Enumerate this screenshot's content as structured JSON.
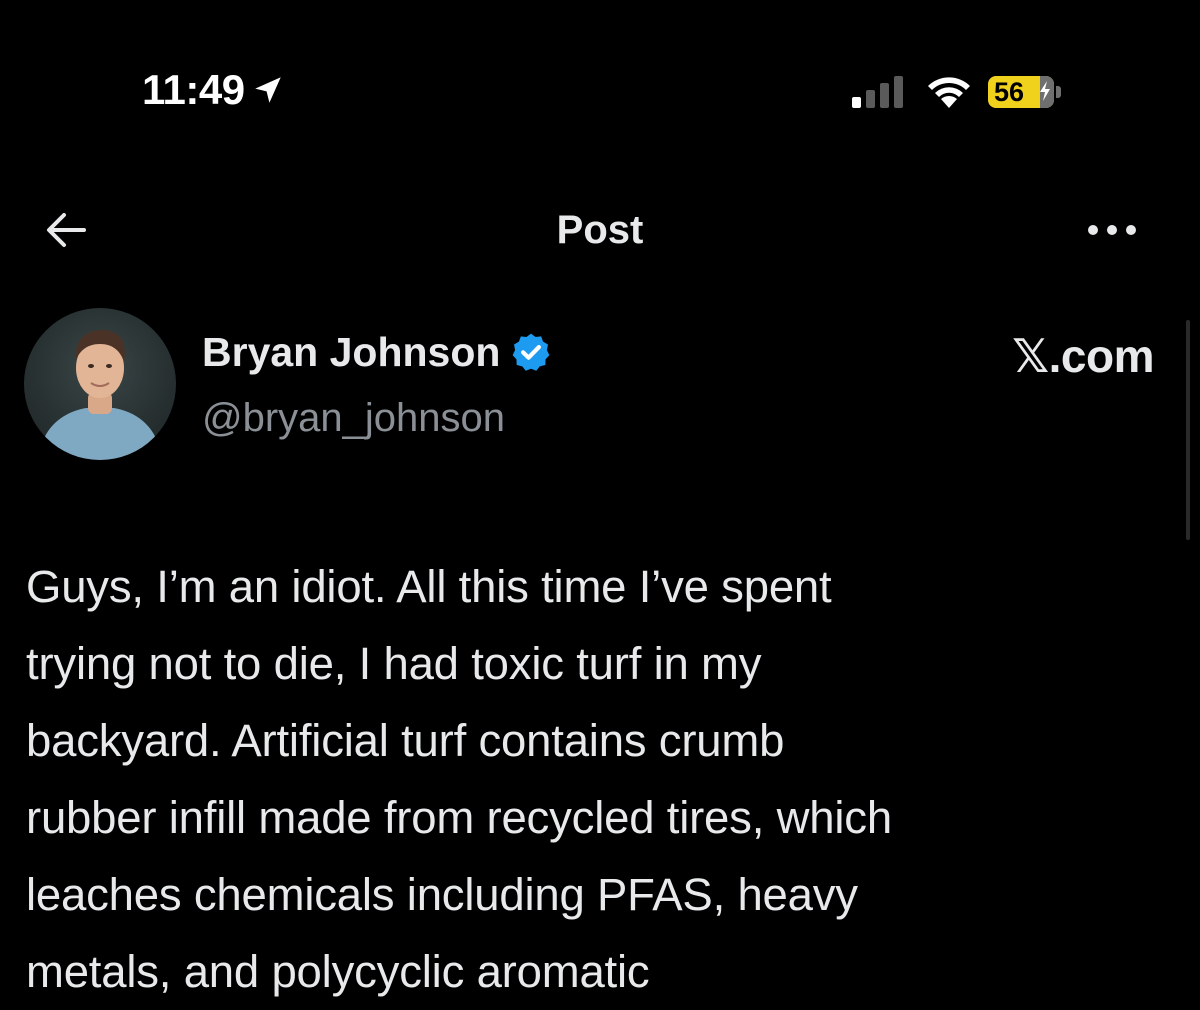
{
  "status_bar": {
    "time": "11:49",
    "location_icon": "location-arrow-icon",
    "signal_icon": "cellular-signal-icon",
    "wifi_icon": "wifi-icon",
    "battery_level": "56",
    "battery_charging": true,
    "battery_color": "#f0d11c"
  },
  "header": {
    "back_icon": "back-arrow-icon",
    "title": "Post",
    "more_icon": "more-horizontal-icon"
  },
  "author": {
    "display_name": "Bryan Johnson",
    "verified": true,
    "verified_color": "#1d9bf0",
    "handle": "@bryan_johnson",
    "avatar_icon": "user-avatar"
  },
  "watermark": "𝕏.com",
  "post": {
    "text": "Guys, I’m an idiot. All this time I’ve spent\ntrying not to die, I had toxic turf in my\nbackyard.  Artificial turf contains crumb\nrubber infill made from recycled tires, which\nleaches chemicals including PFAS, heavy\nmetals, and polycyclic aromatic"
  },
  "theme": {
    "background": "#000000",
    "text": "#e7e9ea",
    "secondary_text": "#8b9096"
  }
}
